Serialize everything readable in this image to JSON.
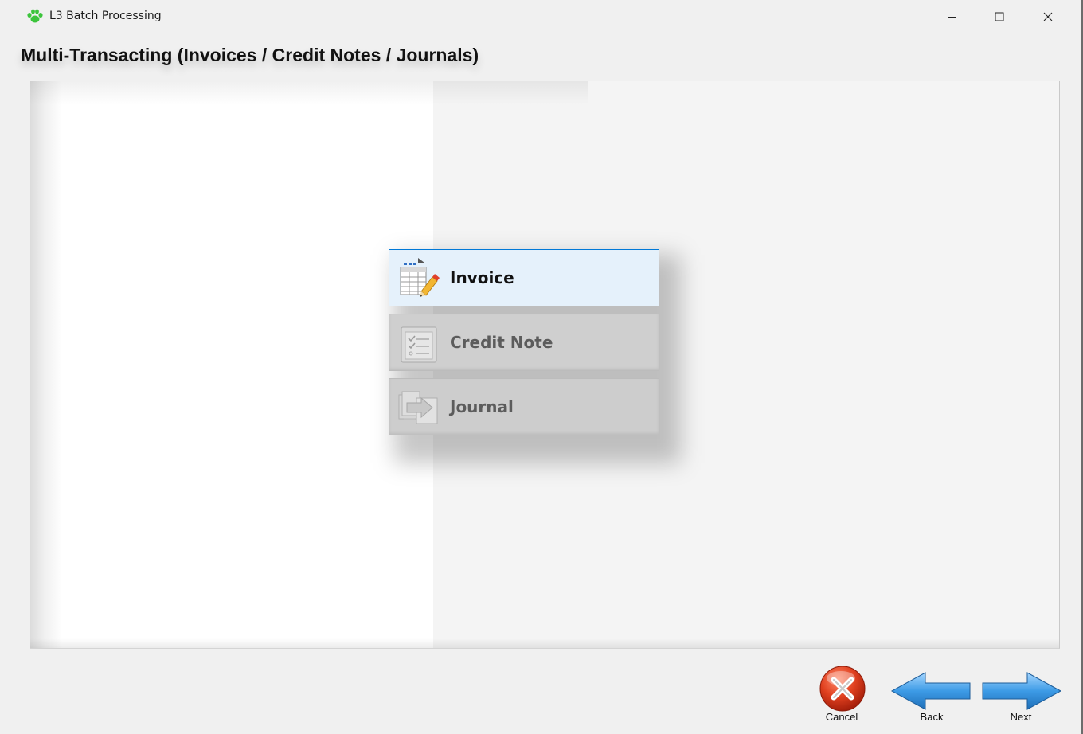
{
  "window": {
    "title": "L3 Batch Processing",
    "app_icon": "paw-icon",
    "controls": {
      "minimize": "minimize-icon",
      "maximize": "maximize-icon",
      "close": "close-icon"
    }
  },
  "heading": "Multi-Transacting (Invoices / Credit Notes / Journals)",
  "options": [
    {
      "label": "Invoice",
      "icon": "invoice-edit-icon",
      "state": "selected",
      "accent": "#0078d7"
    },
    {
      "label": "Credit Note",
      "icon": "checklist-icon",
      "state": "disabled"
    },
    {
      "label": "Journal",
      "icon": "journal-icon",
      "state": "disabled"
    }
  ],
  "footer": {
    "cancel_label": "Cancel",
    "back_label": "Back",
    "next_label": "Next"
  },
  "colors": {
    "paw_green": "#3cc43c",
    "cancel_red": "#d73a1f",
    "arrow_blue": "#2f8fd8"
  }
}
